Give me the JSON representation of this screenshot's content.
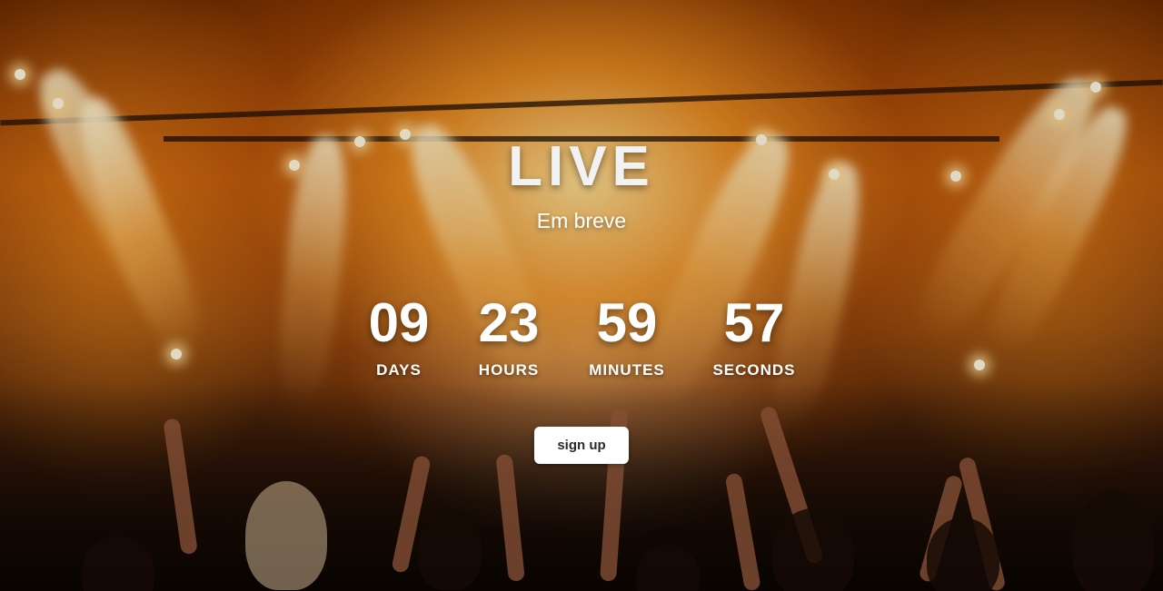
{
  "hero": {
    "title": "LIVE",
    "subtitle": "Em breve"
  },
  "countdown": [
    {
      "value": "09",
      "label": "DAYS"
    },
    {
      "value": "23",
      "label": "HOURS"
    },
    {
      "value": "59",
      "label": "MINUTES"
    },
    {
      "value": "57",
      "label": "SECONDS"
    }
  ],
  "signup_button": {
    "label": "sign up"
  },
  "colors": {
    "text": "#ffffff",
    "button_bg": "#ffffff",
    "button_text": "#2a2a2a",
    "background_tone": "#c8620a"
  }
}
